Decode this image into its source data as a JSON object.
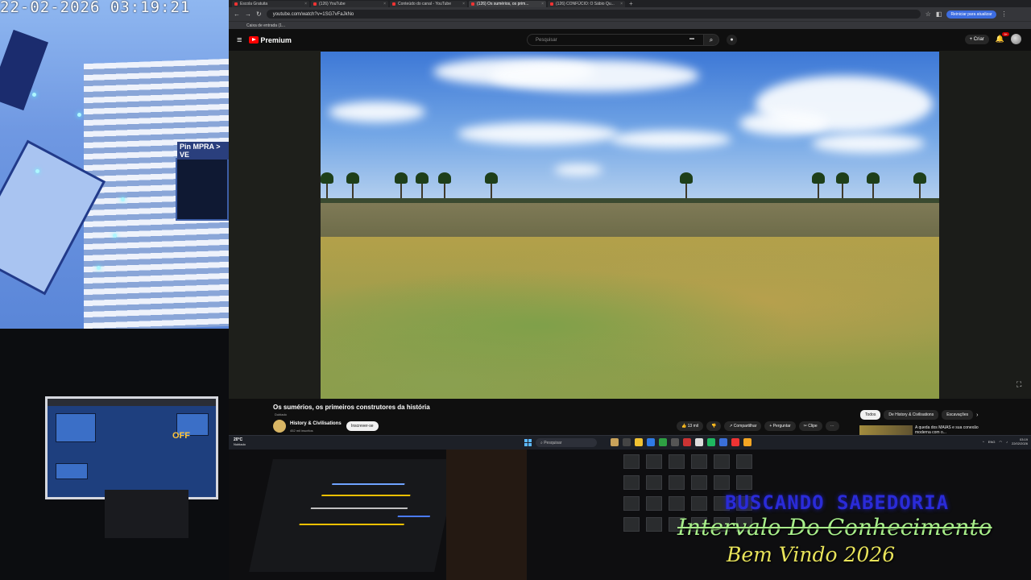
{
  "camera": {
    "timestamp": "22-02-2026 03:19:21",
    "sign_text": "MPRA > VE",
    "sign_prefix": "Pin"
  },
  "browser": {
    "tabs": [
      {
        "label": "Escola Gratuita",
        "active": false
      },
      {
        "label": "(126) YouTube",
        "active": false
      },
      {
        "label": "Conteúdo do canal - YouTube",
        "active": false
      },
      {
        "label": "(126) Os sumérios, os prim...",
        "active": true
      },
      {
        "label": "(126) CONFÚCIO: O Sábio Qu...",
        "active": false
      }
    ],
    "new_tab": "+",
    "url": "youtube.com/watch?v=1SG7vFaJkNo",
    "reiniciar_label": "Reiniciar para atualizar",
    "bookmark": "Caixa de entrada (1..."
  },
  "youtube": {
    "logo_text": "Premium",
    "search_placeholder": "Pesquisar",
    "create_label": "+ Criar",
    "notif_count": "9+",
    "video_title": "Os sumérios, os primeiros construtores da história",
    "video_subtitle": "Dublado",
    "channel_name": "History & Civilisations",
    "channel_subs": "452 mil inscritos",
    "subscribe_label": "Inscrever-se",
    "actions": [
      "👍 13 mil",
      "👎",
      "↗ Compartilhar",
      "+ Perguntar",
      "✂ Clipe",
      "⋯"
    ],
    "chips": [
      "Todos",
      "De History & Civilisations",
      "Escavações"
    ],
    "recommended_title": "A queda dos MAIAS e sua conexão moderna com o..."
  },
  "taskbar": {
    "temperature": "20°C",
    "weather": "Nublado",
    "search_placeholder": "Pesquisar",
    "lang": "ENG",
    "time": "03:19",
    "date": "22/02/2026"
  },
  "overlay": {
    "line1": "BUSCANDO SABEDORIA",
    "line2": "Intervalo Do Conhecimento",
    "line3": "Bem Vindo 2026"
  },
  "studio_monitor": {
    "off_text": "OFF"
  }
}
